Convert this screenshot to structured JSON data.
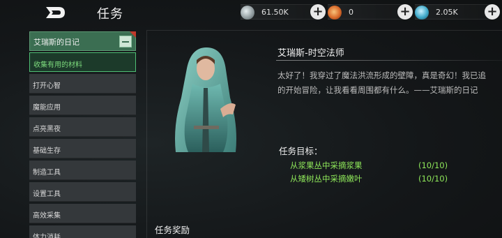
{
  "header": {
    "title": "任务",
    "resources": [
      {
        "name": "coin",
        "value": "61.50K",
        "icon": "coin-icon",
        "color": "#9aa5a8"
      },
      {
        "name": "gem",
        "value": "0",
        "icon": "gem-icon",
        "color": "#d96a2a"
      },
      {
        "name": "crystal",
        "value": "2.05K",
        "icon": "crystal-icon",
        "color": "#3fa9c9"
      }
    ]
  },
  "sidebar": {
    "header_label": "艾瑞斯的日记",
    "items": [
      {
        "label": "收集有用的材料",
        "active": true
      },
      {
        "label": "打开心智",
        "active": false
      },
      {
        "label": "魔能应用",
        "active": false
      },
      {
        "label": "点亮黑夜",
        "active": false
      },
      {
        "label": "基础生存",
        "active": false
      },
      {
        "label": "制造工具",
        "active": false
      },
      {
        "label": "设置工具",
        "active": false
      },
      {
        "label": "高效采集",
        "active": false
      },
      {
        "label": "体力消耗",
        "active": false
      }
    ]
  },
  "quest": {
    "npc_name": "艾瑞斯-时空法师",
    "description_line1": "太好了！我穿过了魔法洪流形成的壁障，真是奇幻！我已追",
    "description_line2": "的开始冒险，让我看看周围都有什么。——艾瑞斯的日记",
    "objectives_title": "任务目标：",
    "objectives": [
      {
        "text": "从浆果丛中采摘浆果",
        "progress": "(10/10)"
      },
      {
        "text": "从矮树丛中采摘嫩叶",
        "progress": "(10/10)"
      }
    ],
    "rewards_title": "任务奖励"
  }
}
